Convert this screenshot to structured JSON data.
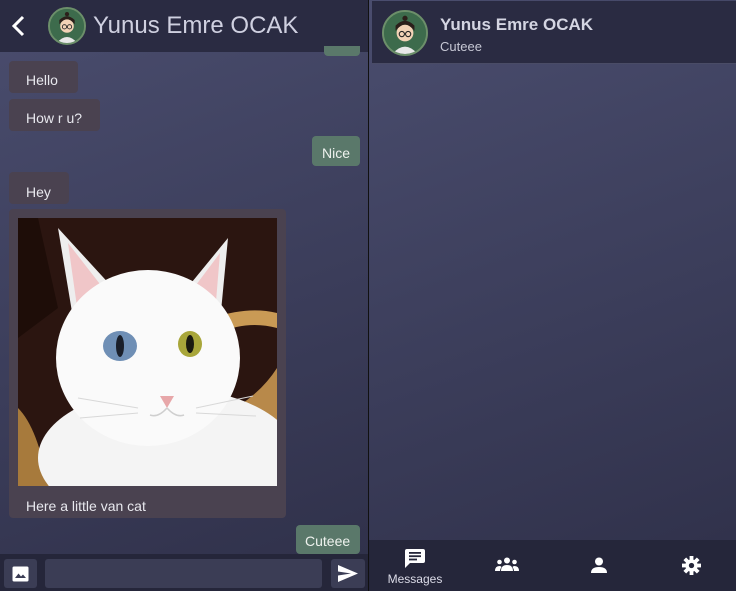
{
  "chat": {
    "contact_name": "Yunus Emre OCAK",
    "messages": [
      {
        "from": "contact",
        "text": "Hello"
      },
      {
        "from": "contact",
        "text": "How r u?"
      },
      {
        "from": "me",
        "text": "Nice"
      },
      {
        "from": "contact",
        "text": "Hey"
      },
      {
        "from": "contact",
        "type": "photo",
        "image": "white van cat with heterochromatic eyes",
        "caption": "Here a little van cat"
      },
      {
        "from": "me",
        "text": "Cuteee"
      }
    ],
    "composer": {
      "input_value": "",
      "image_icon": "image-icon",
      "send_icon": "send-icon"
    }
  },
  "conversations": [
    {
      "name": "Yunus Emre OCAK",
      "last_message": "Cuteee"
    }
  ],
  "nav": {
    "items": [
      {
        "icon": "messages-icon",
        "label": "Messages",
        "active": true
      },
      {
        "icon": "groups-icon"
      },
      {
        "icon": "profile-icon"
      },
      {
        "icon": "settings-icon"
      }
    ]
  },
  "colors": {
    "header": "#2a2b42",
    "incoming_bubble": "#4a4250",
    "outgoing_bubble": "#5a786a",
    "background": "#3b3d5a"
  }
}
